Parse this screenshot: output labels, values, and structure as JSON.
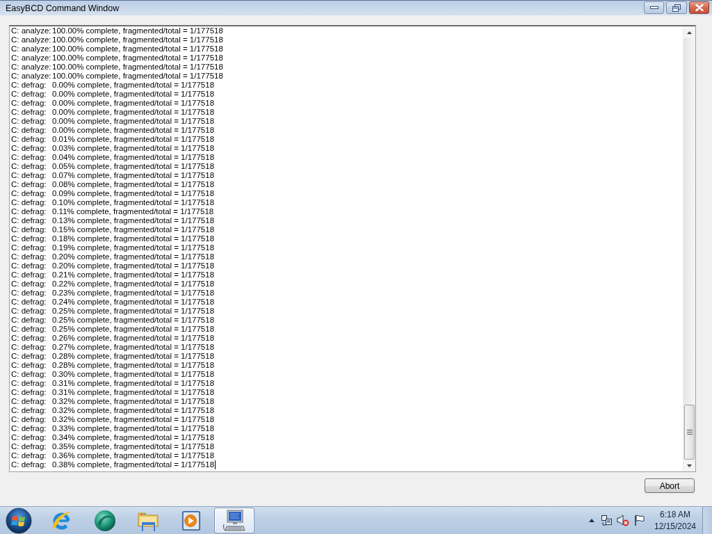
{
  "window": {
    "title": "EasyBCD Command Window"
  },
  "console": {
    "focused": true,
    "lines": [
      {
        "label": "C: analyze:",
        "text": "100.00% complete, fragmented/total = 1/177518"
      },
      {
        "label": "C: analyze:",
        "text": "100.00% complete, fragmented/total = 1/177518"
      },
      {
        "label": "C: analyze:",
        "text": "100.00% complete, fragmented/total = 1/177518"
      },
      {
        "label": "C: analyze:",
        "text": "100.00% complete, fragmented/total = 1/177518"
      },
      {
        "label": "C: analyze:",
        "text": "100.00% complete, fragmented/total = 1/177518"
      },
      {
        "label": "C: analyze:",
        "text": "100.00% complete, fragmented/total = 1/177518"
      },
      {
        "label": "C: defrag:",
        "text": "0.00% complete, fragmented/total = 1/177518"
      },
      {
        "label": "C: defrag:",
        "text": "0.00% complete, fragmented/total = 1/177518"
      },
      {
        "label": "C: defrag:",
        "text": "0.00% complete, fragmented/total = 1/177518"
      },
      {
        "label": "C: defrag:",
        "text": "0.00% complete, fragmented/total = 1/177518"
      },
      {
        "label": "C: defrag:",
        "text": "0.00% complete, fragmented/total = 1/177518"
      },
      {
        "label": "C: defrag:",
        "text": "0.00% complete, fragmented/total = 1/177518"
      },
      {
        "label": "C: defrag:",
        "text": "0.01% complete, fragmented/total = 1/177518"
      },
      {
        "label": "C: defrag:",
        "text": "0.03% complete, fragmented/total = 1/177518"
      },
      {
        "label": "C: defrag:",
        "text": "0.04% complete, fragmented/total = 1/177518"
      },
      {
        "label": "C: defrag:",
        "text": "0.05% complete, fragmented/total = 1/177518"
      },
      {
        "label": "C: defrag:",
        "text": "0.07% complete, fragmented/total = 1/177518"
      },
      {
        "label": "C: defrag:",
        "text": "0.08% complete, fragmented/total = 1/177518"
      },
      {
        "label": "C: defrag:",
        "text": "0.09% complete, fragmented/total = 1/177518"
      },
      {
        "label": "C: defrag:",
        "text": "0.10% complete, fragmented/total = 1/177518"
      },
      {
        "label": "C: defrag:",
        "text": "0.11% complete, fragmented/total = 1/177518"
      },
      {
        "label": "C: defrag:",
        "text": "0.13% complete, fragmented/total = 1/177518"
      },
      {
        "label": "C: defrag:",
        "text": "0.15% complete, fragmented/total = 1/177518"
      },
      {
        "label": "C: defrag:",
        "text": "0.18% complete, fragmented/total = 1/177518"
      },
      {
        "label": "C: defrag:",
        "text": "0.19% complete, fragmented/total = 1/177518"
      },
      {
        "label": "C: defrag:",
        "text": "0.20% complete, fragmented/total = 1/177518"
      },
      {
        "label": "C: defrag:",
        "text": "0.20% complete, fragmented/total = 1/177518"
      },
      {
        "label": "C: defrag:",
        "text": "0.21% complete, fragmented/total = 1/177518"
      },
      {
        "label": "C: defrag:",
        "text": "0.22% complete, fragmented/total = 1/177518"
      },
      {
        "label": "C: defrag:",
        "text": "0.23% complete, fragmented/total = 1/177518"
      },
      {
        "label": "C: defrag:",
        "text": "0.24% complete, fragmented/total = 1/177518"
      },
      {
        "label": "C: defrag:",
        "text": "0.25% complete, fragmented/total = 1/177518"
      },
      {
        "label": "C: defrag:",
        "text": "0.25% complete, fragmented/total = 1/177518"
      },
      {
        "label": "C: defrag:",
        "text": "0.25% complete, fragmented/total = 1/177518"
      },
      {
        "label": "C: defrag:",
        "text": "0.26% complete, fragmented/total = 1/177518"
      },
      {
        "label": "C: defrag:",
        "text": "0.27% complete, fragmented/total = 1/177518"
      },
      {
        "label": "C: defrag:",
        "text": "0.28% complete, fragmented/total = 1/177518"
      },
      {
        "label": "C: defrag:",
        "text": "0.28% complete, fragmented/total = 1/177518"
      },
      {
        "label": "C: defrag:",
        "text": "0.30% complete, fragmented/total = 1/177518"
      },
      {
        "label": "C: defrag:",
        "text": "0.31% complete, fragmented/total = 1/177518"
      },
      {
        "label": "C: defrag:",
        "text": "0.31% complete, fragmented/total = 1/177518"
      },
      {
        "label": "C: defrag:",
        "text": "0.32% complete, fragmented/total = 1/177518"
      },
      {
        "label": "C: defrag:",
        "text": "0.32% complete, fragmented/total = 1/177518"
      },
      {
        "label": "C: defrag:",
        "text": "0.32% complete, fragmented/total = 1/177518"
      },
      {
        "label": "C: defrag:",
        "text": "0.33% complete, fragmented/total = 1/177518"
      },
      {
        "label": "C: defrag:",
        "text": "0.34% complete, fragmented/total = 1/177518"
      },
      {
        "label": "C: defrag:",
        "text": "0.35% complete, fragmented/total = 1/177518"
      },
      {
        "label": "C: defrag:",
        "text": "0.36% complete, fragmented/total = 1/177518"
      },
      {
        "label": "C: defrag:",
        "text": "0.38% complete, fragmented/total = 1/177518"
      }
    ]
  },
  "abort_button": {
    "label": "Abort"
  },
  "taskbar": {
    "apps": [
      {
        "kind": "browser",
        "selected": false
      },
      {
        "kind": "sphere",
        "selected": false
      },
      {
        "kind": "folder",
        "selected": false
      },
      {
        "kind": "media",
        "selected": false
      },
      {
        "kind": "computer",
        "selected": true
      }
    ],
    "tray": [
      {
        "kind": "chevron"
      },
      {
        "kind": "network"
      },
      {
        "kind": "volume",
        "muted": true
      },
      {
        "kind": "flag"
      }
    ],
    "clock": {
      "time": "6:18 AM",
      "date": "12/15/2024"
    }
  }
}
